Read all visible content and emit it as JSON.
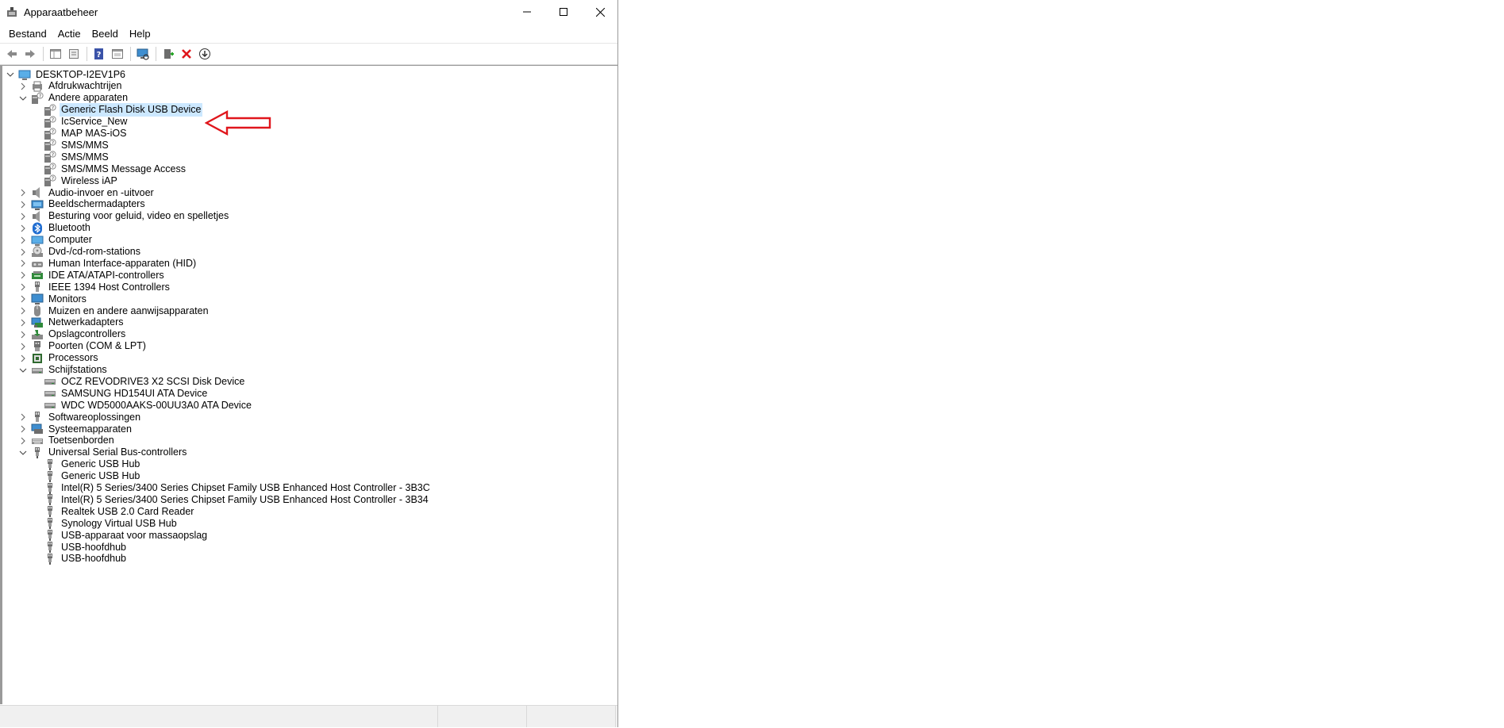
{
  "window": {
    "title": "Apparaatbeheer",
    "app_icon": "device-manager-icon"
  },
  "menu": [
    "Bestand",
    "Actie",
    "Beeld",
    "Help"
  ],
  "toolbar": [
    "back-arrow-icon",
    "forward-arrow-icon",
    "show-hide-tree-icon",
    "properties-icon",
    "help-icon",
    "view-icon",
    "scan-hardware-icon",
    "update-driver-icon",
    "uninstall-device-icon",
    "download-driver-icon"
  ],
  "tree": {
    "root": "DESKTOP-I2EV1P6",
    "items": [
      {
        "label": "Afdrukwachtrijen",
        "level": 1,
        "expander": "collapsed",
        "icon": "printer-queue-icon"
      },
      {
        "label": "Andere apparaten",
        "level": 1,
        "expander": "expanded",
        "icon": "unknown-device-icon"
      },
      {
        "label": "Generic Flash Disk USB Device",
        "level": 2,
        "expander": "none",
        "icon": "unknown-device-icon",
        "selected": true
      },
      {
        "label": "IcService_New",
        "level": 2,
        "expander": "none",
        "icon": "unknown-device-icon"
      },
      {
        "label": "MAP MAS-iOS",
        "level": 2,
        "expander": "none",
        "icon": "unknown-device-icon"
      },
      {
        "label": "SMS/MMS",
        "level": 2,
        "expander": "none",
        "icon": "unknown-device-icon"
      },
      {
        "label": "SMS/MMS",
        "level": 2,
        "expander": "none",
        "icon": "unknown-device-icon"
      },
      {
        "label": "SMS/MMS Message Access",
        "level": 2,
        "expander": "none",
        "icon": "unknown-device-icon"
      },
      {
        "label": "Wireless iAP",
        "level": 2,
        "expander": "none",
        "icon": "unknown-device-icon"
      },
      {
        "label": "Audio-invoer en -uitvoer",
        "level": 1,
        "expander": "collapsed",
        "icon": "speaker-icon"
      },
      {
        "label": "Beeldschermadapters",
        "level": 1,
        "expander": "collapsed",
        "icon": "display-adapter-icon"
      },
      {
        "label": "Besturing voor geluid, video en spelletjes",
        "level": 1,
        "expander": "collapsed",
        "icon": "speaker-icon"
      },
      {
        "label": "Bluetooth",
        "level": 1,
        "expander": "collapsed",
        "icon": "bluetooth-icon"
      },
      {
        "label": "Computer",
        "level": 1,
        "expander": "collapsed",
        "icon": "computer-icon"
      },
      {
        "label": "Dvd-/cd-rom-stations",
        "level": 1,
        "expander": "collapsed",
        "icon": "disc-drive-icon"
      },
      {
        "label": "Human Interface-apparaten (HID)",
        "level": 1,
        "expander": "collapsed",
        "icon": "hid-icon"
      },
      {
        "label": "IDE ATA/ATAPI-controllers",
        "level": 1,
        "expander": "collapsed",
        "icon": "ide-controller-icon"
      },
      {
        "label": "IEEE 1394 Host Controllers",
        "level": 1,
        "expander": "collapsed",
        "icon": "plug-icon"
      },
      {
        "label": "Monitors",
        "level": 1,
        "expander": "collapsed",
        "icon": "monitor-icon"
      },
      {
        "label": "Muizen en andere aanwijsapparaten",
        "level": 1,
        "expander": "collapsed",
        "icon": "mouse-icon"
      },
      {
        "label": "Netwerkadapters",
        "level": 1,
        "expander": "collapsed",
        "icon": "network-adapter-icon"
      },
      {
        "label": "Opslagcontrollers",
        "level": 1,
        "expander": "collapsed",
        "icon": "storage-controller-icon"
      },
      {
        "label": "Poorten (COM & LPT)",
        "level": 1,
        "expander": "collapsed",
        "icon": "port-icon"
      },
      {
        "label": "Processors",
        "level": 1,
        "expander": "collapsed",
        "icon": "processor-icon"
      },
      {
        "label": "Schijfstations",
        "level": 1,
        "expander": "expanded",
        "icon": "disk-drive-icon"
      },
      {
        "label": "OCZ REVODRIVE3 X2 SCSI Disk Device",
        "level": 2,
        "expander": "none",
        "icon": "disk-drive-icon"
      },
      {
        "label": "SAMSUNG HD154UI ATA Device",
        "level": 2,
        "expander": "none",
        "icon": "disk-drive-icon"
      },
      {
        "label": "WDC WD5000AAKS-00UU3A0 ATA Device",
        "level": 2,
        "expander": "none",
        "icon": "disk-drive-icon"
      },
      {
        "label": "Softwareoplossingen",
        "level": 1,
        "expander": "collapsed",
        "icon": "plug-icon"
      },
      {
        "label": "Systeemapparaten",
        "level": 1,
        "expander": "collapsed",
        "icon": "system-device-icon"
      },
      {
        "label": "Toetsenborden",
        "level": 1,
        "expander": "collapsed",
        "icon": "keyboard-icon"
      },
      {
        "label": "Universal Serial Bus-controllers",
        "level": 1,
        "expander": "expanded",
        "icon": "usb-plug-icon"
      },
      {
        "label": "Generic USB Hub",
        "level": 2,
        "expander": "none",
        "icon": "usb-plug-icon"
      },
      {
        "label": "Generic USB Hub",
        "level": 2,
        "expander": "none",
        "icon": "usb-plug-icon"
      },
      {
        "label": "Intel(R) 5 Series/3400 Series Chipset Family USB Enhanced Host Controller - 3B3C",
        "level": 2,
        "expander": "none",
        "icon": "usb-plug-icon"
      },
      {
        "label": "Intel(R) 5 Series/3400 Series Chipset Family USB Enhanced Host Controller - 3B34",
        "level": 2,
        "expander": "none",
        "icon": "usb-plug-icon"
      },
      {
        "label": "Realtek USB 2.0 Card Reader",
        "level": 2,
        "expander": "none",
        "icon": "usb-plug-icon"
      },
      {
        "label": "Synology Virtual USB Hub",
        "level": 2,
        "expander": "none",
        "icon": "usb-plug-icon"
      },
      {
        "label": "USB-apparaat voor massaopslag",
        "level": 2,
        "expander": "none",
        "icon": "usb-plug-icon"
      },
      {
        "label": "USB-hoofdhub",
        "level": 2,
        "expander": "none",
        "icon": "usb-plug-icon"
      },
      {
        "label": "USB-hoofdhub",
        "level": 2,
        "expander": "none",
        "icon": "usb-plug-icon"
      }
    ]
  },
  "annotation": {
    "icon": "red-arrow-icon",
    "color": "#e0161c"
  },
  "colors": {
    "selection": "#cce8ff",
    "accent": "#0078d7"
  }
}
